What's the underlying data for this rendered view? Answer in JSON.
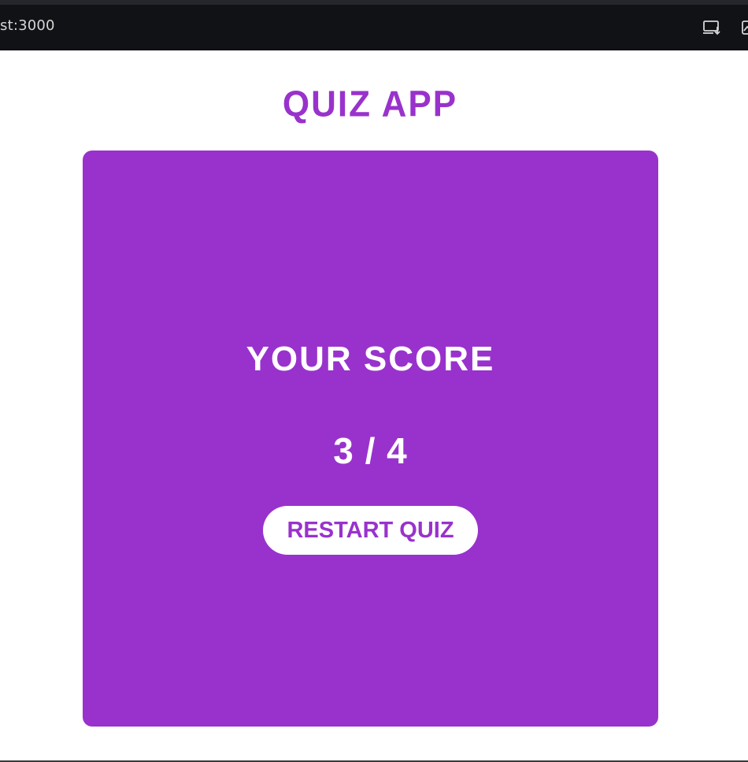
{
  "browser": {
    "url": "st:3000",
    "icons": [
      "install-app-icon",
      "performance-icon"
    ]
  },
  "app": {
    "title": "QUIZ APP",
    "accent_color": "#9932cc"
  },
  "result": {
    "heading": "YOUR SCORE",
    "score_text": "3 / 4",
    "restart_label": "RESTART QUIZ"
  }
}
